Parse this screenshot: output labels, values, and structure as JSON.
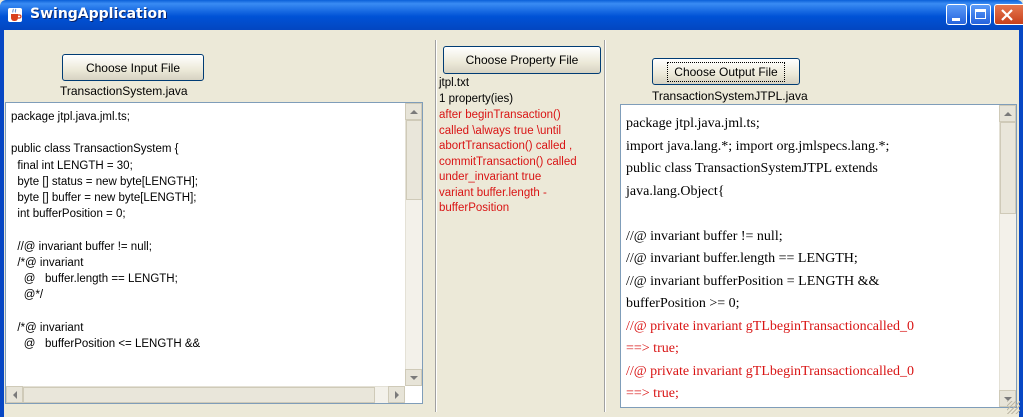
{
  "window": {
    "title": "SwingApplication",
    "icon": "java-cup-icon"
  },
  "colors": {
    "titlebar": "#0a5fd8",
    "highlight_text": "#d91414",
    "scrollpane_border": "#7f9db9",
    "panel_bg": "#ece9d8"
  },
  "input_panel": {
    "button_label": "Choose Input File",
    "file_name": "TransactionSystem.java",
    "code_lines": [
      "package jtpl.java.jml.ts;",
      "",
      "public class TransactionSystem {",
      "  final int LENGTH = 30;",
      "  byte [] status = new byte[LENGTH];",
      "  byte [] buffer = new byte[LENGTH];",
      "  int bufferPosition = 0;",
      "",
      "  //@ invariant buffer != null;",
      "  /*@ invariant",
      "    @   buffer.length == LENGTH;",
      "    @*/",
      "",
      "  /*@ invariant",
      "    @   bufferPosition <= LENGTH &&"
    ]
  },
  "property_panel": {
    "button_label": "Choose Property File",
    "file_name": "jtpl.txt",
    "property_count": "1 property(ies)",
    "property_lines": [
      "after beginTransaction()",
      "called \\always true \\until",
      "abortTransaction() called ,",
      "commitTransaction() called",
      "under_invariant true",
      "variant buffer.length -",
      "bufferPosition"
    ]
  },
  "output_panel": {
    "button_label": "Choose Output File",
    "file_name": "TransactionSystemJTPL.java",
    "code_lines": [
      {
        "text": "package jtpl.java.jml.ts;",
        "highlight": false
      },
      {
        "text": "import java.lang.*; import org.jmlspecs.lang.*;",
        "highlight": false
      },
      {
        "text": "public class TransactionSystemJTPL extends",
        "highlight": false
      },
      {
        "text": "java.lang.Object{",
        "highlight": false
      },
      {
        "text": "",
        "highlight": false
      },
      {
        "text": "//@ invariant buffer != null;",
        "highlight": false
      },
      {
        "text": "//@ invariant buffer.length == LENGTH;",
        "highlight": false
      },
      {
        "text": "//@ invariant bufferPosition = LENGTH &&",
        "highlight": false
      },
      {
        "text": "bufferPosition >= 0;",
        "highlight": false
      },
      {
        "text": "//@ private invariant gTLbeginTransactioncalled_0",
        "highlight": true
      },
      {
        "text": "==> true;",
        "highlight": true
      },
      {
        "text": "//@ private invariant gTLbeginTransactioncalled_0",
        "highlight": true
      },
      {
        "text": "==> true;",
        "highlight": true
      }
    ]
  }
}
